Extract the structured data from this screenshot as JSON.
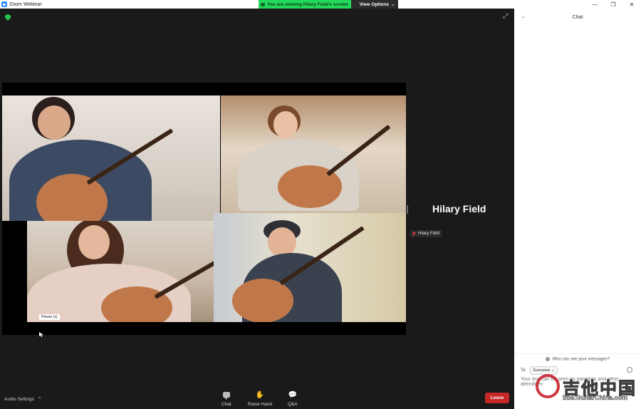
{
  "window": {
    "title": "Zoom Webinar",
    "controls": {
      "minimize": "—",
      "restore": "❐",
      "close": "✕"
    }
  },
  "banner": {
    "viewing_text": "You are viewing Hilary Field's screen",
    "view_options": "View Options"
  },
  "share": {
    "name_tag": "Please (s)"
  },
  "speaker": {
    "name": "Hilary Field",
    "badge": "Hilary Field"
  },
  "toolbar": {
    "audio_settings": "Audio Settings",
    "chat": "Chat",
    "raise_hand": "Raise Hand",
    "qa": "Q&A",
    "leave": "Leave"
  },
  "chat_panel": {
    "title": "Chat",
    "who_can_see": "Who can see your messages?",
    "to_label": "To:",
    "to_value": "Everyone",
    "input_placeholder": "Your text can be seen by panelists and other attendees"
  },
  "watermark": {
    "text": "吉他中国",
    "url": "bbs.GuitarChina.com"
  },
  "colors": {
    "banner_green": "#23d959",
    "leave_red": "#c62828",
    "shield_green": "#23c552",
    "background": "#1a1a1a"
  },
  "icons": [
    "zoom-app-icon",
    "security-shield-icon",
    "expand-icon",
    "chat-icon",
    "raise-hand-icon",
    "qa-icon",
    "mic-muted-icon",
    "emoji-icon",
    "chevron-down-icon"
  ]
}
